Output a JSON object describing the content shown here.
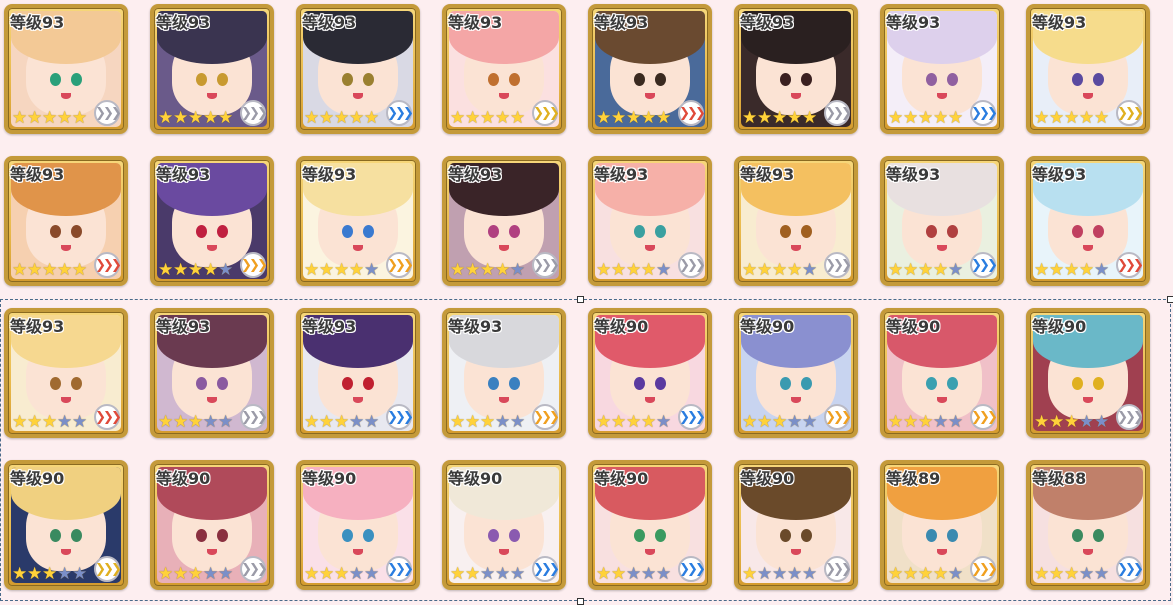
{
  "level_prefix": "等级",
  "colors": {
    "card_border": "#c49a3a",
    "star_on": "#ffd23a",
    "star_off": "#7b8fc8",
    "selection_border": "#4a6a8a"
  },
  "rank_colors": {
    "gray": "#9b9ba8",
    "blue": "#2a7de0",
    "red": "#e04a3a",
    "orange": "#f0a020",
    "gold": "#e0b020"
  },
  "characters": [
    {
      "level": "等级93",
      "stars": 5,
      "rank": "gray",
      "hair": "#f3c996",
      "eye": "#2aa07a",
      "bg": "#f6d6c0"
    },
    {
      "level": "等级93",
      "stars": 5,
      "rank": "gray",
      "hair": "#3a3450",
      "eye": "#c89a30",
      "bg": "#6a5a8a"
    },
    {
      "level": "等级93",
      "stars": 5,
      "rank": "blue",
      "hair": "#2a2a34",
      "eye": "#9a8030",
      "bg": "#d9d9e4"
    },
    {
      "level": "等级93",
      "stars": 5,
      "rank": "gold",
      "hair": "#f4a6a6",
      "eye": "#c07030",
      "bg": "#fbe0e0"
    },
    {
      "level": "等级93",
      "stars": 5,
      "rank": "red",
      "hair": "#6a4a30",
      "eye": "#3a2a20",
      "bg": "#4a6a9a"
    },
    {
      "level": "等级93",
      "stars": 5,
      "rank": "gray",
      "hair": "#2a2020",
      "eye": "#3a2020",
      "bg": "#3a2a2a"
    },
    {
      "level": "等级93",
      "stars": 5,
      "rank": "blue",
      "hair": "#ddd0ec",
      "eye": "#9060a0",
      "bg": "#f4eef8"
    },
    {
      "level": "等级93",
      "stars": 5,
      "rank": "gold",
      "hair": "#f6dc8c",
      "eye": "#5a4aa0",
      "bg": "#e8eef8"
    },
    {
      "level": "等级93",
      "stars": 5,
      "rank": "red",
      "hair": "#e0944a",
      "eye": "#8a4a2a",
      "bg": "#f6d0b0"
    },
    {
      "level": "等级93",
      "stars": 4,
      "rank": "orange",
      "hair": "#6a4aa0",
      "eye": "#c02040",
      "bg": "#4a3a6a"
    },
    {
      "level": "等级93",
      "stars": 4,
      "rank": "orange",
      "hair": "#f6e0a0",
      "eye": "#3a7ad0",
      "bg": "#fbf4e0"
    },
    {
      "level": "等级93",
      "stars": 4,
      "rank": "gray",
      "hair": "#3a2428",
      "eye": "#b04080",
      "bg": "#c0a0b0"
    },
    {
      "level": "等级93",
      "stars": 4,
      "rank": "gray",
      "hair": "#f6b0a8",
      "eye": "#3aa0a0",
      "bg": "#f8e0e0"
    },
    {
      "level": "等级93",
      "stars": 4,
      "rank": "gray",
      "hair": "#f4c060",
      "eye": "#a06020",
      "bg": "#f8ecd0"
    },
    {
      "level": "等级93",
      "stars": 4,
      "rank": "blue",
      "hair": "#e8e0e0",
      "eye": "#b04040",
      "bg": "#eaf0e0"
    },
    {
      "level": "等级93",
      "stars": 4,
      "rank": "red",
      "hair": "#b8e0f0",
      "eye": "#c04060",
      "bg": "#e8f4fa"
    },
    {
      "level": "等级93",
      "stars": 3,
      "rank": "red",
      "hair": "#f6d890",
      "eye": "#a06a30",
      "bg": "#f8ecd0"
    },
    {
      "level": "等级93",
      "stars": 3,
      "rank": "gray",
      "hair": "#6a3a50",
      "eye": "#8a5aa0",
      "bg": "#d0b8d0"
    },
    {
      "level": "等级93",
      "stars": 3,
      "rank": "blue",
      "hair": "#4a3070",
      "eye": "#c02030",
      "bg": "#e8e8f0"
    },
    {
      "level": "等级93",
      "stars": 3,
      "rank": "orange",
      "hair": "#d8d8dc",
      "eye": "#3a80c0",
      "bg": "#eef0f4"
    },
    {
      "level": "等级90",
      "stars": 4,
      "rank": "blue",
      "hair": "#e05a6a",
      "eye": "#5a3aa0",
      "bg": "#f8d8e0"
    },
    {
      "level": "等级90",
      "stars": 3,
      "rank": "orange",
      "hair": "#8a90d0",
      "eye": "#3a9ab0",
      "bg": "#c8d4f0"
    },
    {
      "level": "等级90",
      "stars": 3,
      "rank": "orange",
      "hair": "#d8586a",
      "eye": "#3aa0b0",
      "bg": "#f0c0c8"
    },
    {
      "level": "等级90",
      "stars": 3,
      "rank": "gray",
      "hair": "#6ab8c8",
      "eye": "#e0b020",
      "bg": "#a04050"
    },
    {
      "level": "等级90",
      "stars": 3,
      "rank": "gold",
      "hair": "#f0d080",
      "eye": "#3a8a60",
      "bg": "#2a3a6a"
    },
    {
      "level": "等级90",
      "stars": 3,
      "rank": "gray",
      "hair": "#b04a5a",
      "eye": "#8a3040",
      "bg": "#e8b0b8"
    },
    {
      "level": "等级90",
      "stars": 3,
      "rank": "blue",
      "hair": "#f6b0c0",
      "eye": "#3a90c0",
      "bg": "#fae0e8"
    },
    {
      "level": "等级90",
      "stars": 2,
      "rank": "blue",
      "hair": "#f0e8d8",
      "eye": "#8a5ab0",
      "bg": "#f8f0f0"
    },
    {
      "level": "等级90",
      "stars": 2,
      "rank": "blue",
      "hair": "#d85a60",
      "eye": "#3a9a60",
      "bg": "#f8e0e0"
    },
    {
      "level": "等级90",
      "stars": 1,
      "rank": "gray",
      "hair": "#6a4a2a",
      "eye": "#6a4a2a",
      "bg": "#f8e8e8"
    },
    {
      "level": "等级89",
      "stars": 4,
      "rank": "orange",
      "hair": "#f0a040",
      "eye": "#3a8ab0",
      "bg": "#f0e0c8"
    },
    {
      "level": "等级88",
      "stars": 3,
      "rank": "blue",
      "hair": "#c0806a",
      "eye": "#3a8a60",
      "bg": "#f6e0e0"
    }
  ]
}
